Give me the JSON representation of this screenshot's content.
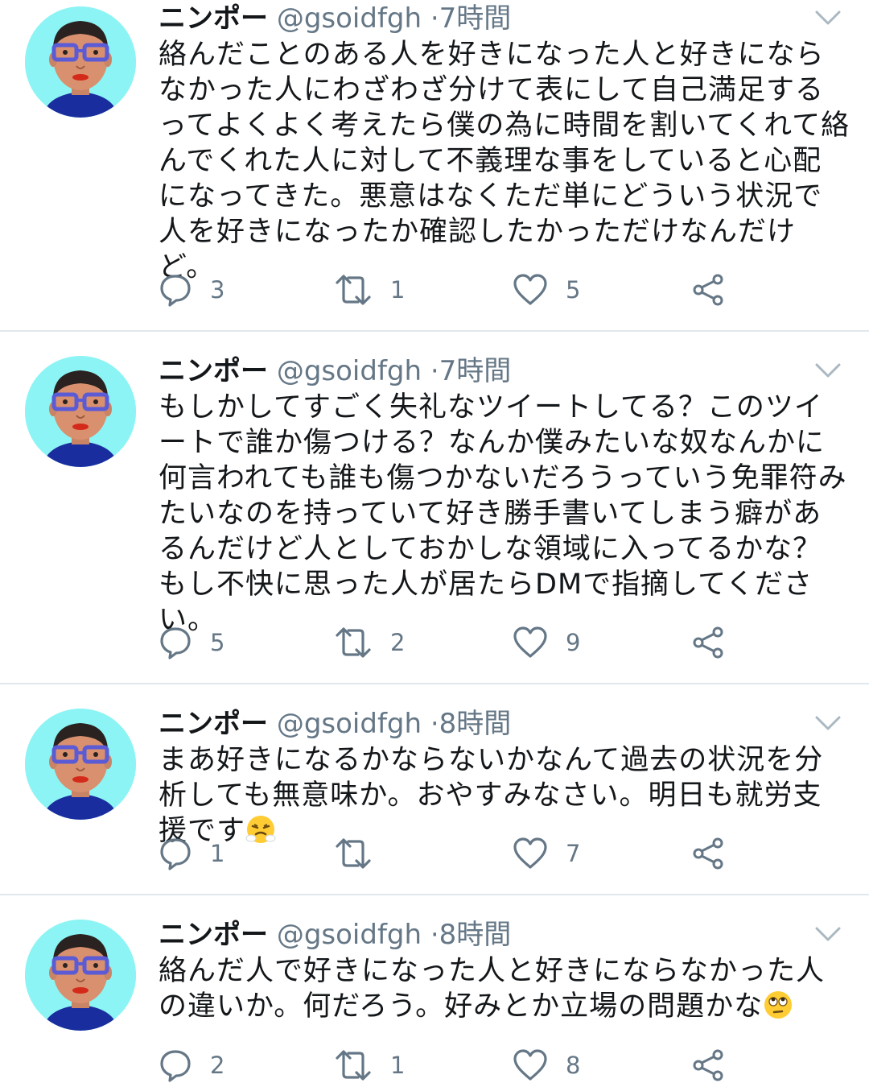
{
  "tweets": [
    {
      "name": "ニンポー",
      "handle": "@gsoidfgh",
      "separator": "·",
      "time": "7時間",
      "text": "絡んだことのある人を好きになった人と好きにならなかった人にわざわざ分けて表にして自己満足するってよくよく考えたら僕の為に時間を割いてくれて絡んでくれた人に対して不義理な事をしていると心配になってきた。悪意はなくただ単にどういう状況で人を好きになったか確認したかっただけなんだけど。",
      "replies": "3",
      "retweets": "1",
      "likes": "5"
    },
    {
      "name": "ニンポー",
      "handle": "@gsoidfgh",
      "separator": "·",
      "time": "7時間",
      "text": "もしかしてすごく失礼なツイートしてる？このツイートで誰か傷つける？なんか僕みたいな奴なんかに何言われても誰も傷つかないだろうっていう免罪符みたいなのを持っていて好き勝手書いてしまう癖があるんだけど人としておかしな領域に入ってるかな？もし不快に思った人が居たらDMで指摘してください。",
      "replies": "5",
      "retweets": "2",
      "likes": "9"
    },
    {
      "name": "ニンポー",
      "handle": "@gsoidfgh",
      "separator": "·",
      "time": "8時間",
      "text": "まあ好きになるかならないかなんて過去の状況を分析しても無意味か。おやすみなさい。明日も就労支援です",
      "emoji": "face-with-steam-emoji",
      "replies": "1",
      "retweets": "",
      "likes": "7"
    },
    {
      "name": "ニンポー",
      "handle": "@gsoidfgh",
      "separator": "·",
      "time": "8時間",
      "text": "絡んだ人で好きになった人と好きにならなかった人の違いか。何だろう。好みとか立場の問題かな",
      "emoji": "face-with-rolling-eyes-emoji",
      "replies": "2",
      "retweets": "1",
      "likes": "8"
    }
  ],
  "icons": {
    "reply": "reply-icon",
    "retweet": "retweet-icon",
    "like": "heart-icon",
    "share": "share-icon",
    "menu": "chevron-down-icon"
  },
  "colors": {
    "text": "#14171a",
    "secondary": "#657786",
    "divider": "#e1e8ed",
    "avatar_bg": "#8cf4f4",
    "glasses": "#5b5bd6",
    "shirt": "#1a2d9e"
  }
}
